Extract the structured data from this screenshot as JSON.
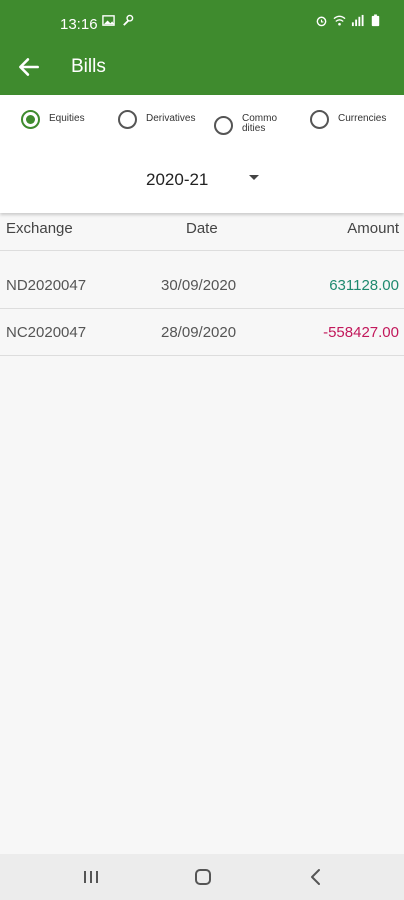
{
  "status_bar": {
    "time": "13:16"
  },
  "app_bar": {
    "title": "Bills"
  },
  "segments": [
    {
      "label": "Equities",
      "checked": true
    },
    {
      "label": "Derivatives",
      "checked": false
    },
    {
      "label": "Commodities",
      "checked": false
    },
    {
      "label": "Currencies",
      "checked": false
    }
  ],
  "year_select": {
    "value": "2020-21"
  },
  "table": {
    "headers": {
      "exchange": "Exchange",
      "date": "Date",
      "amount": "Amount"
    },
    "rows": [
      {
        "exchange": "ND2020047",
        "date": "30/09/2020",
        "amount": "631128.00"
      },
      {
        "exchange": "NC2020047",
        "date": "28/09/2020",
        "amount": "-558427.00"
      }
    ]
  },
  "colors": {
    "primary": "#3f8b2e",
    "positive": "#1f8a6f",
    "negative": "#c2185b"
  }
}
